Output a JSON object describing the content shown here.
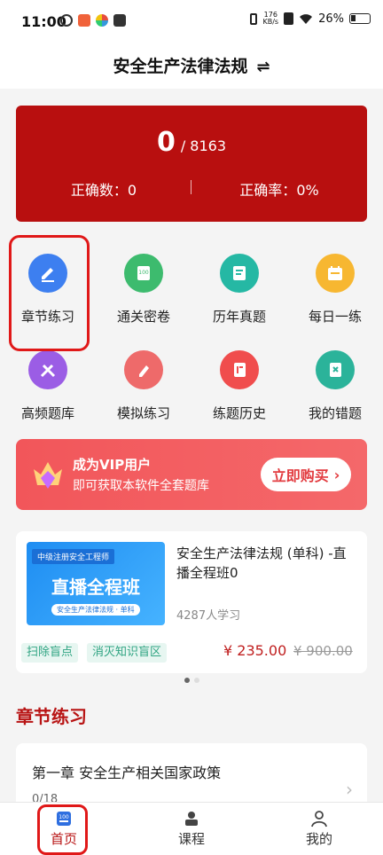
{
  "status_bar": {
    "time": "11:00",
    "speed_value": "176",
    "speed_unit": "KB/s",
    "battery": "26%"
  },
  "header": {
    "title": "安全生产法律法规",
    "switch_icon": "swap-icon"
  },
  "stats": {
    "answered": "0",
    "total": "/ 8163",
    "correct_label": "正确数：",
    "correct_value": "0",
    "rate_label": "正确率：",
    "rate_value": "0%"
  },
  "grid": {
    "items": [
      {
        "label": "章节练习",
        "icon": "pencil-icon",
        "color": "#3d7ff0"
      },
      {
        "label": "通关密卷",
        "icon": "paper-100-icon",
        "color": "#3dbb6e"
      },
      {
        "label": "历年真题",
        "icon": "document-icon",
        "color": "#25b8a4"
      },
      {
        "label": "每日一练",
        "icon": "calendar-icon",
        "color": "#f7b731"
      },
      {
        "label": "高频题库",
        "icon": "pen-cross-icon",
        "color": "#9b5de5"
      },
      {
        "label": "模拟练习",
        "icon": "pencil-circle-icon",
        "color": "#ee6a6a"
      },
      {
        "label": "练题历史",
        "icon": "history-book-icon",
        "color": "#f04d4d"
      },
      {
        "label": "我的错题",
        "icon": "wrong-book-icon",
        "color": "#2bb39a"
      }
    ]
  },
  "vip": {
    "title": "成为VIP用户",
    "subtitle": "即可获取本软件全套题库",
    "button": "立即购买"
  },
  "course": {
    "thumb_top": "中级注册安全工程师",
    "thumb_main": "直播全程班",
    "thumb_sub": "安全生产法律法规 · 单科",
    "title": "安全生产法律法规 (单科) -直播全程班0",
    "students": "4287人学习",
    "tags": [
      "扫除盲点",
      "消灭知识盲区"
    ],
    "price": "¥ 235.00",
    "original_price": "¥ 900.00"
  },
  "section": {
    "title": "章节练习",
    "chapter_name": "第一章  安全生产相关国家政策",
    "chapter_progress": "0/18"
  },
  "nav": {
    "items": [
      {
        "label": "首页",
        "icon": "home-100-icon",
        "active": true
      },
      {
        "label": "课程",
        "icon": "course-teacher-icon",
        "active": false
      },
      {
        "label": "我的",
        "icon": "person-icon",
        "active": false
      }
    ]
  }
}
